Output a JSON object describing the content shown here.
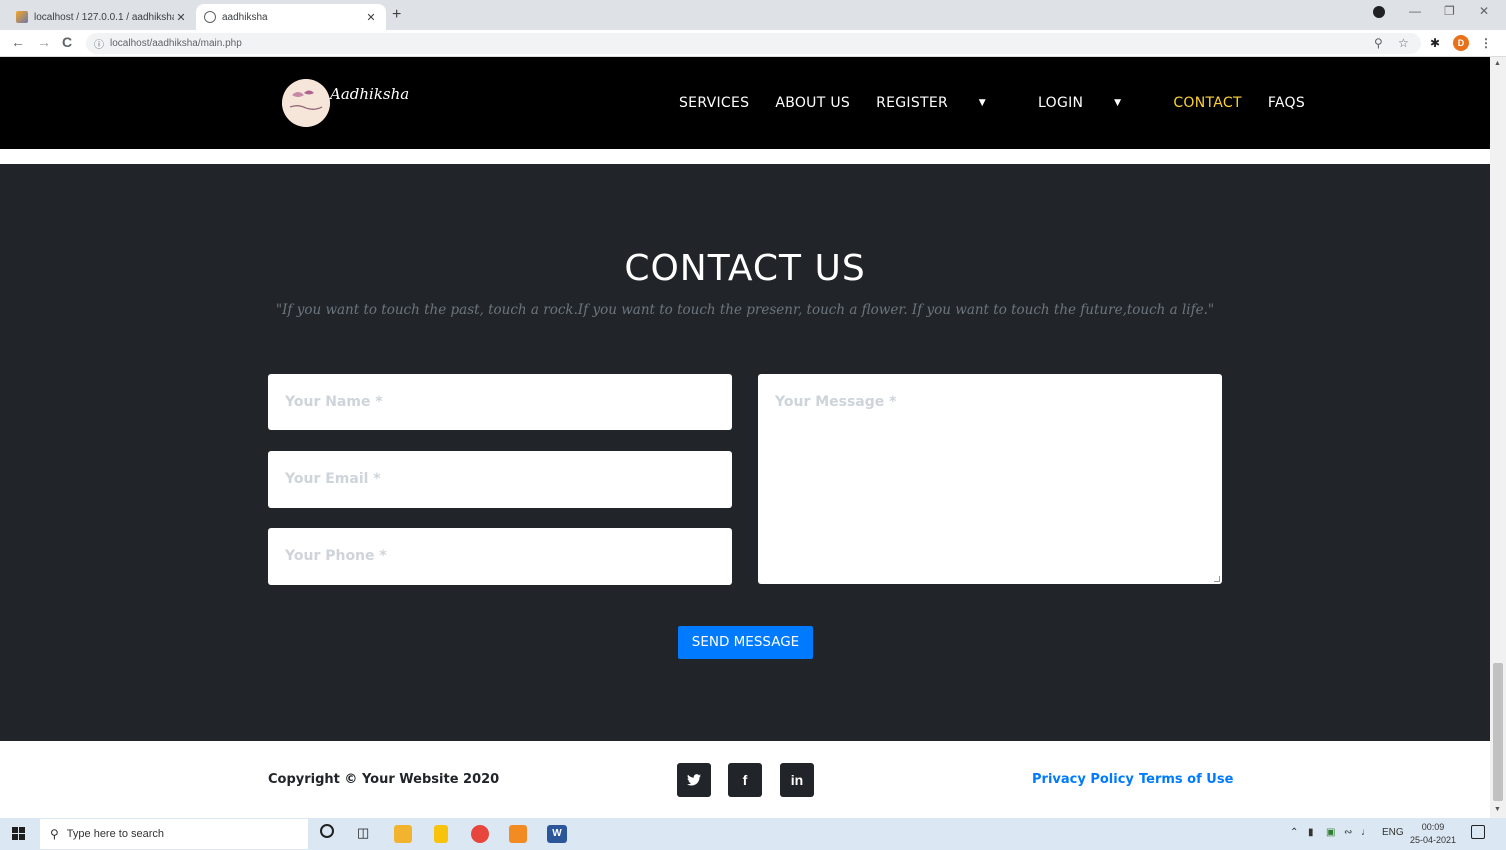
{
  "browser": {
    "tabs": [
      {
        "title": "localhost / 127.0.0.1 / aadhiksha",
        "close": "✕"
      },
      {
        "title": "aadhiksha",
        "close": "✕"
      }
    ],
    "new_tab": "+",
    "url": "localhost/aadhiksha/main.php",
    "profile_initial": "D"
  },
  "site": {
    "logo_text": "Aadhiksha",
    "nav": {
      "services": "SERVICES",
      "about": "ABOUT US",
      "register": "REGISTER",
      "login": "LOGIN",
      "contact": "CONTACT",
      "faqs": "FAQS"
    },
    "accent_color": "#fed136"
  },
  "contact": {
    "heading": "CONTACT US",
    "quote": "\"If you want to touch the past, touch a rock.If you want to touch the presenr, touch a flower. If you want to touch the future,touch a life.\"",
    "name_placeholder": "Your Name *",
    "email_placeholder": "Your Email *",
    "phone_placeholder": "Your Phone *",
    "message_placeholder": "Your Message *",
    "send_label": "SEND MESSAGE"
  },
  "footer": {
    "copyright": "Copyright © Your Website 2020",
    "social": [
      "twitter-icon",
      "facebook-icon",
      "linkedin-icon"
    ],
    "privacy": "Privacy Policy",
    "terms": "Terms of Use"
  },
  "taskbar": {
    "search_placeholder": "Type here to search",
    "language": "ENG",
    "time": "00:09",
    "date": "25-04-2021"
  }
}
